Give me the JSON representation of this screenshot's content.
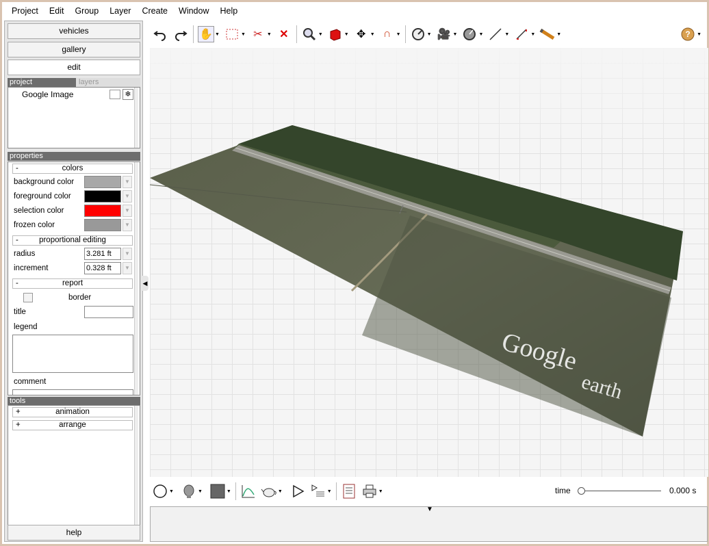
{
  "menu": [
    "Project",
    "Edit",
    "Group",
    "Layer",
    "Create",
    "Window",
    "Help"
  ],
  "left": {
    "buttons": [
      "vehicles",
      "gallery",
      "edit"
    ],
    "project_tab": "project",
    "layers_tab": "layers",
    "layer_item": "Google Image",
    "properties_header": "properties",
    "colors": {
      "header": "colors",
      "toggle": "-",
      "rows": [
        {
          "label": "background color",
          "color": "#a8a8a8"
        },
        {
          "label": "foreground color",
          "color": "#000000"
        },
        {
          "label": "selection color",
          "color": "#ff0000"
        },
        {
          "label": "frozen color",
          "color": "#999999"
        }
      ]
    },
    "proportional": {
      "header": "proportional editing",
      "toggle": "-",
      "radius_label": "radius",
      "radius_value": "3.281 ft",
      "increment_label": "increment",
      "increment_value": "0.328 ft"
    },
    "report": {
      "header": "report",
      "toggle": "-",
      "border_label": "border",
      "title_label": "title",
      "legend_label": "legend",
      "comment_label": "comment"
    },
    "tools_header": "tools",
    "tools": [
      {
        "toggle": "+",
        "label": "animation"
      },
      {
        "toggle": "+",
        "label": "arrange"
      }
    ],
    "help": "help"
  },
  "toolbar": {
    "icons": [
      "undo-icon",
      "redo-icon",
      "hand-pan-icon",
      "select-rect-icon",
      "cut-icon",
      "delete-icon",
      "zoom-icon",
      "cube-icon",
      "move-icon",
      "magnet-icon",
      "measure-icon",
      "camera-icon",
      "circle-tool-icon",
      "line-icon",
      "scale-icon",
      "pencil-icon",
      "help-icon"
    ]
  },
  "viewport": {
    "watermark_line1": "Google",
    "watermark_line2": "earth"
  },
  "bottom": {
    "time_label": "time",
    "time_value": "0.000 s"
  }
}
